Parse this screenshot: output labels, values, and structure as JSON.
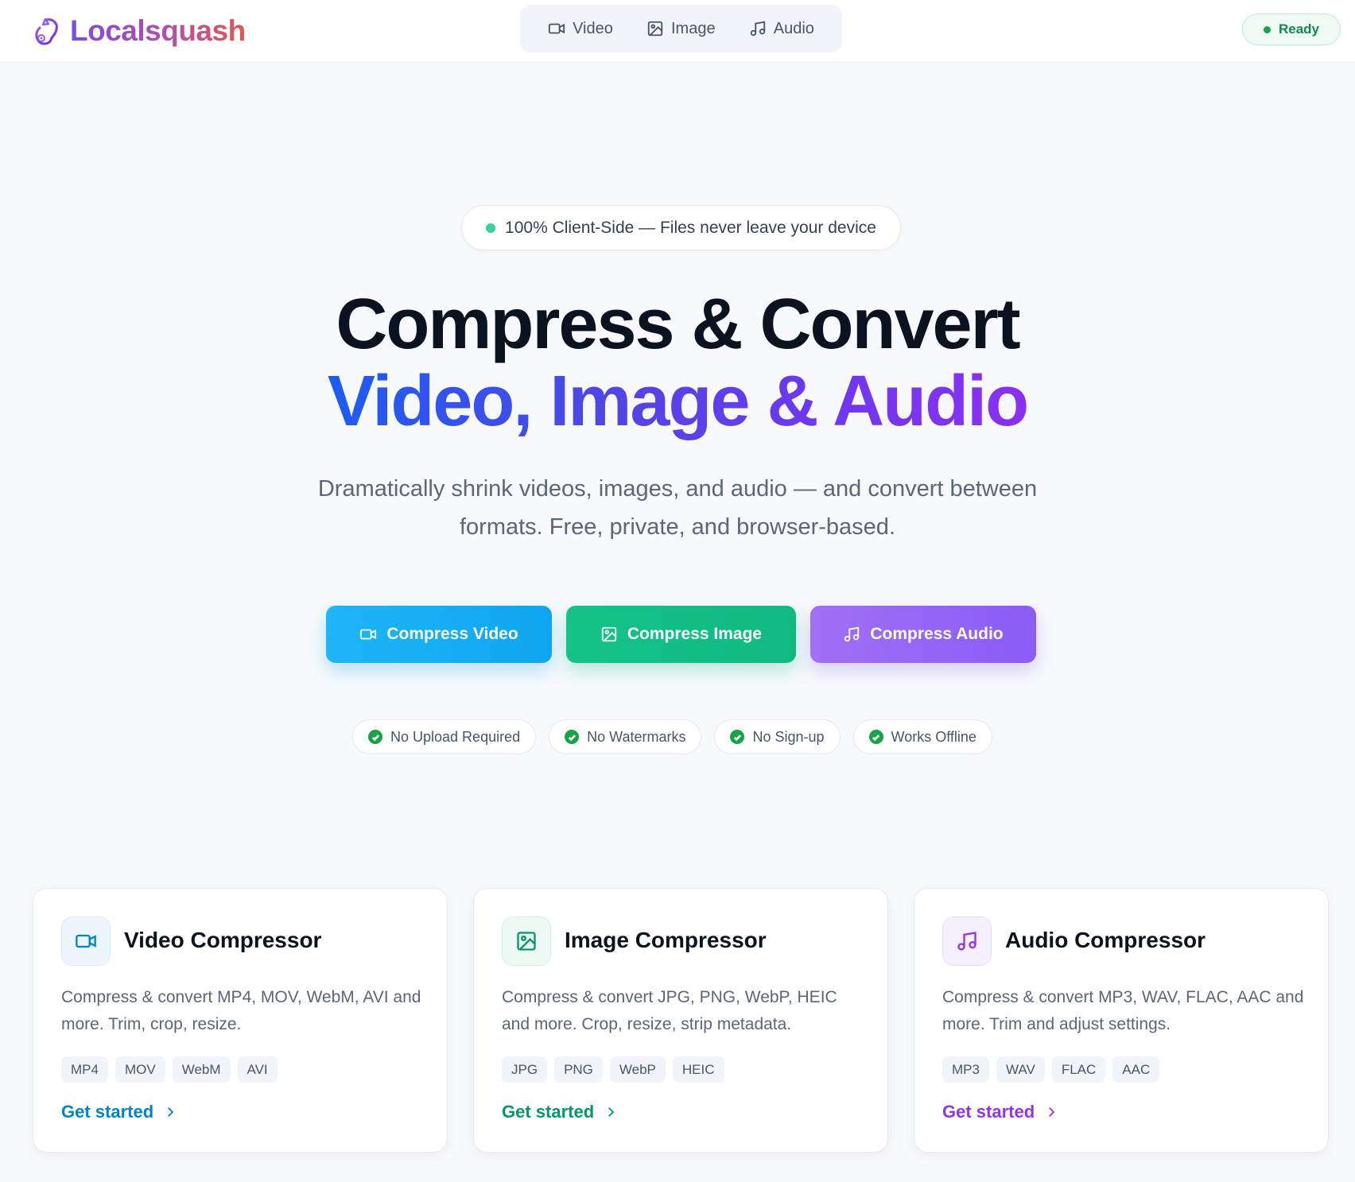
{
  "app": {
    "name": "Localsquash"
  },
  "nav": {
    "items": [
      {
        "label": "Video",
        "icon": "video-icon"
      },
      {
        "label": "Image",
        "icon": "image-icon"
      },
      {
        "label": "Audio",
        "icon": "music-icon"
      }
    ]
  },
  "status": {
    "label": "Ready",
    "color": "#16a34a"
  },
  "hero": {
    "pill": "100% Client-Side — Files never leave your device",
    "title_line1": "Compress & Convert",
    "title_line2": "Video, Image & Audio",
    "subtitle": "Dramatically shrink videos, images, and audio — and convert between formats. Free, private, and browser-based."
  },
  "cta": {
    "video": "Compress Video",
    "image": "Compress Image",
    "audio": "Compress Audio"
  },
  "features": [
    "No Upload Required",
    "No Watermarks",
    "No Sign-up",
    "Works Offline"
  ],
  "cards": [
    {
      "title": "Video Compressor",
      "description": "Compress & convert MP4, MOV, WebM, AVI and more. Trim, crop, resize.",
      "tags": [
        "MP4",
        "MOV",
        "WebM",
        "AVI"
      ],
      "link": "Get started",
      "accent": "#0284c7"
    },
    {
      "title": "Image Compressor",
      "description": "Compress & convert JPG, PNG, WebP, HEIC and more. Crop, resize, strip metadata.",
      "tags": [
        "JPG",
        "PNG",
        "WebP",
        "HEIC"
      ],
      "link": "Get started",
      "accent": "#059669"
    },
    {
      "title": "Audio Compressor",
      "description": "Compress & convert MP3, WAV, FLAC, AAC and more. Trim and adjust settings.",
      "tags": [
        "MP3",
        "WAV",
        "FLAC",
        "AAC"
      ],
      "link": "Get started",
      "accent": "#9333ea"
    }
  ]
}
